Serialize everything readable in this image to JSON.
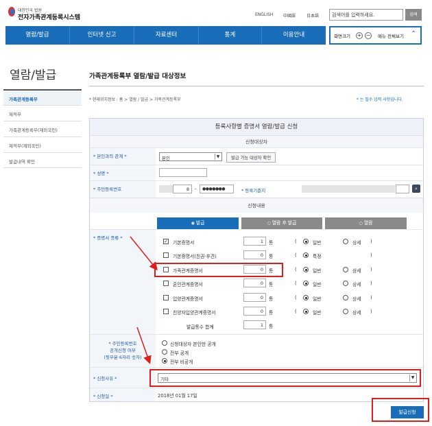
{
  "header": {
    "logo_sub": "대한민국 법원",
    "logo_main": "전자가족관계등록시스템",
    "links": [
      "ENGLISH",
      "中國語",
      "日本語"
    ],
    "search_placeholder": "검색어를 입력하세요.",
    "search_button": "검색"
  },
  "nav": {
    "items": [
      "열람/발급",
      "인터넷 신고",
      "자료센터",
      "통계",
      "이용안내"
    ],
    "zoom_label": "화면크기",
    "menu_all": "메뉴 전체보기"
  },
  "sidebar": {
    "title": "열람/발급",
    "items": [
      "가족관계등록부",
      "제적부",
      "가족관계등록부(재외국민)",
      "제적부(재외국민)",
      "발급내역 확인"
    ]
  },
  "main": {
    "title": "가족관계등록부 열람/발급 대상정보",
    "breadcrumb": "* 현재위치정보 : 홈 > 열람 / 발급 > 가족관계등록부",
    "required_note": "* 는 필수 입력 사항입니다."
  },
  "form": {
    "header": "등록사항별 증명서 열람/발급 신청",
    "section_target": "신청대상자",
    "relation_label": "* 본인과의 관계 *",
    "relation_value": "본인",
    "check_button": "발급 가능 대상자 확인",
    "name_label": "* 성명 *",
    "rrn_label": "* 주민등록번호",
    "rrn_front_tail": "8",
    "rrn_dash": "-",
    "rrn_back": "●●●●●●●",
    "registry_label": "* 등록기준지",
    "section_content": "신청내용",
    "tabs": [
      "발급",
      "열람 후 발급",
      "열람"
    ],
    "cert_label": "* 증명서 종류 *",
    "certs": [
      {
        "name": "기본증명서",
        "count": "1",
        "unit": "통",
        "type": "일반",
        "alt": "상세",
        "checked": true
      },
      {
        "name": "기본증명서(친권·후견)",
        "count": "0",
        "unit": "통",
        "type": "특정",
        "alt": "",
        "checked": false
      },
      {
        "name": "가족관계증명서",
        "count": "0",
        "unit": "통",
        "type": "일반",
        "alt": "상세",
        "checked": false
      },
      {
        "name": "혼인관계증명서",
        "count": "0",
        "unit": "통",
        "type": "일반",
        "alt": "상세",
        "checked": false
      },
      {
        "name": "입양관계증명서",
        "count": "0",
        "unit": "통",
        "type": "일반",
        "alt": "상세",
        "checked": false
      },
      {
        "name": "친양자입양관계증명서",
        "count": "0",
        "unit": "통",
        "type": "일반",
        "alt": "상세",
        "checked": false
      }
    ],
    "total_label": "발급통수 합계",
    "total_count": "1",
    "total_unit": "통",
    "rrn_disclose_label_lines": [
      "* 주민등록번호",
      "공개신청 여부",
      "(뒷부분 6자리 숫자)"
    ],
    "disclose_options": [
      "신청대상자 본인만 공개",
      "전부 공개",
      "전부 비공개"
    ],
    "reason_label": "* 신청사유 *",
    "reason_value": "기타",
    "date_label": "* 신청일 *",
    "date_value": "2018년 01월 17일",
    "submit": "발급신청"
  }
}
